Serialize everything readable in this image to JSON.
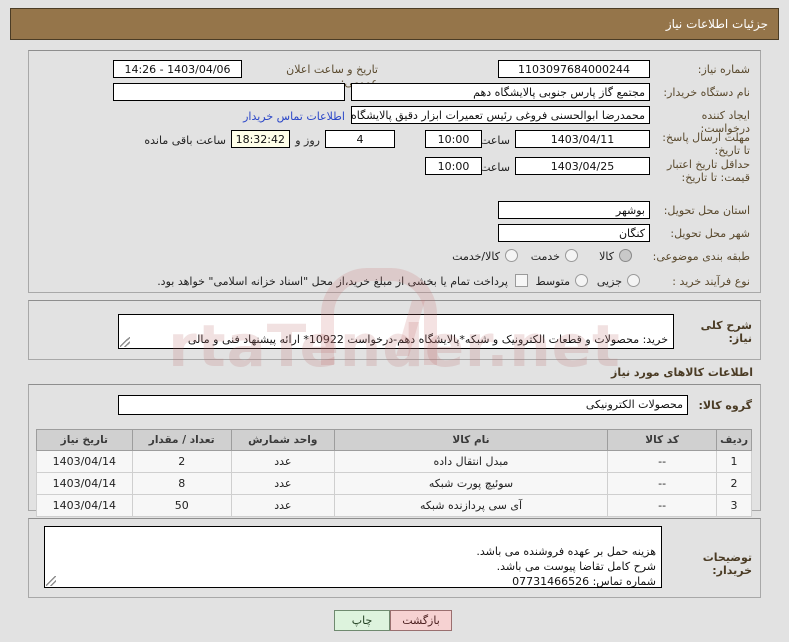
{
  "window": {
    "title": "جزئیات اطلاعات نیاز",
    "title_bar_color": "#95754a"
  },
  "form": {
    "need_number": {
      "label": "شماره نیاز:",
      "value": "1103097684000244"
    },
    "announce_datetime": {
      "label": "تاریخ و ساعت اعلان عمومی:",
      "value": "1403/04/06 - 14:26"
    },
    "buyer_org": {
      "label": "نام دستگاه خریدار:",
      "value": "مجتمع گاز پارس جنوبی  پالایشگاه دهم"
    },
    "buyer_org_secondary": {
      "value": ""
    },
    "creator": {
      "label": "ایجاد کننده درخواست:",
      "value": "محمدرضا ابوالحسنی فروغی رئیس تعمیرات ابزار دقیق پالایشگاه دهم  مجتمع گا"
    },
    "buyer_contact_link": "اطلاعات تماس خریدار",
    "response_deadline": {
      "label": "مهلت ارسال پاسخ: تا تاریخ:",
      "date": "1403/04/11",
      "time_label": "ساعت",
      "time": "10:00",
      "days": "4",
      "days_label": "روز و",
      "countdown": "18:32:42",
      "countdown_label": "ساعت باقی مانده"
    },
    "price_validity": {
      "label": "حداقل تاریخ اعتبار قیمت: تا تاریخ:",
      "date": "1403/04/25",
      "time_label": "ساعت",
      "time": "10:00"
    },
    "delivery_province": {
      "label": "استان محل تحویل:",
      "value": "بوشهر"
    },
    "delivery_city": {
      "label": "شهر محل تحویل:",
      "value": "کنگان"
    },
    "subject_category": {
      "label": "طبقه بندی موضوعی:",
      "options": [
        "کالا",
        "خدمت",
        "کالا/خدمت"
      ],
      "selected": "کالا"
    },
    "purchase_type": {
      "label": "نوع فرآیند خرید :",
      "options": [
        "جزیی",
        "متوسط"
      ],
      "selected": ""
    },
    "treasury_note": {
      "checked": false,
      "text": "پرداخت تمام یا بخشی از مبلغ خرید،از محل \"اسناد خزانه اسلامی\" خواهد بود."
    },
    "general_description": {
      "label": "شرح کلی نیاز:",
      "value": "خرید: محصولات و قطعات الکترونیک و شبکه*پالایشگاه دهم-درخواست 10922* ارائه پیشنهاد فنی و مالی\nمنطبق بر فایل پیوست الزامی است."
    }
  },
  "goods_section": {
    "heading": "اطلاعات کالاهای مورد نیاز",
    "group_label": "گروه کالا:",
    "group_value": "محصولات الکترونیکی",
    "table": {
      "headers": [
        "ردیف",
        "کد کالا",
        "نام کالا",
        "واحد شمارش",
        "تعداد / مقدار",
        "تاریخ نیاز"
      ],
      "rows": [
        {
          "row": "1",
          "code": "--",
          "name": "مبدل انتقال داده",
          "unit": "عدد",
          "qty": "2",
          "date": "1403/04/14"
        },
        {
          "row": "2",
          "code": "--",
          "name": "سوئیچ پورت شبکه",
          "unit": "عدد",
          "qty": "8",
          "date": "1403/04/14"
        },
        {
          "row": "3",
          "code": "--",
          "name": "آی سی پردازنده شبکه",
          "unit": "عدد",
          "qty": "50",
          "date": "1403/04/14"
        }
      ]
    }
  },
  "buyer_notes": {
    "label": "توضیحات خریدار:",
    "value": "هزینه حمل بر عهده فروشنده می باشد.\nشرح کامل تقاضا پیوست می باشد.\nشماره تماس: 07731466526"
  },
  "footer": {
    "print_label": "چاپ",
    "back_label": "بازگشت"
  },
  "watermark": {
    "text": "rtaTender.net"
  }
}
